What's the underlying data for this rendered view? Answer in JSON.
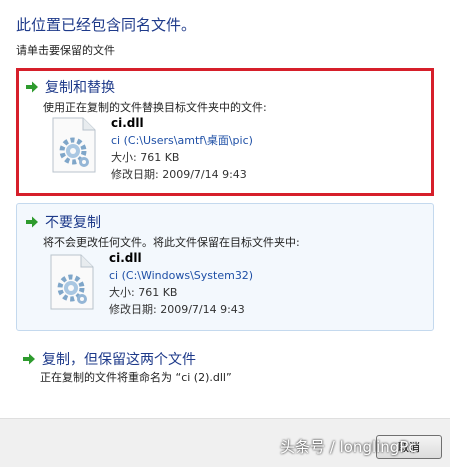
{
  "dialog": {
    "title": "此位置已经包含同名文件。",
    "subtitle": "请单击要保留的文件"
  },
  "options": {
    "replace": {
      "title": "复制和替换",
      "description": "使用正在复制的文件替换目标文件夹中的文件:",
      "file": {
        "name": "ci.dll",
        "path": "ci (C:\\Users\\amtf\\桌面\\pic)",
        "size": "大小: 761 KB",
        "modified": "修改日期: 2009/7/14 9:43"
      }
    },
    "skip": {
      "title": "不要复制",
      "description": "将不会更改任何文件。将此文件保留在目标文件夹中:",
      "file": {
        "name": "ci.dll",
        "path": "ci (C:\\Windows\\System32)",
        "size": "大小: 761 KB",
        "modified": "修改日期: 2009/7/14 9:43"
      }
    },
    "keep_both": {
      "title": "复制，但保留这两个文件",
      "description": "正在复制的文件将重命名为 “ci (2).dll”"
    }
  },
  "footer": {
    "cancel_label": "取消",
    "watermark": "头条号 / longlingPc"
  },
  "colors": {
    "title_blue": "#1e3a8a",
    "highlight_red": "#d61f2a",
    "arrow_green": "#2e9b2e",
    "selected_bg": "#f3f8fd"
  }
}
